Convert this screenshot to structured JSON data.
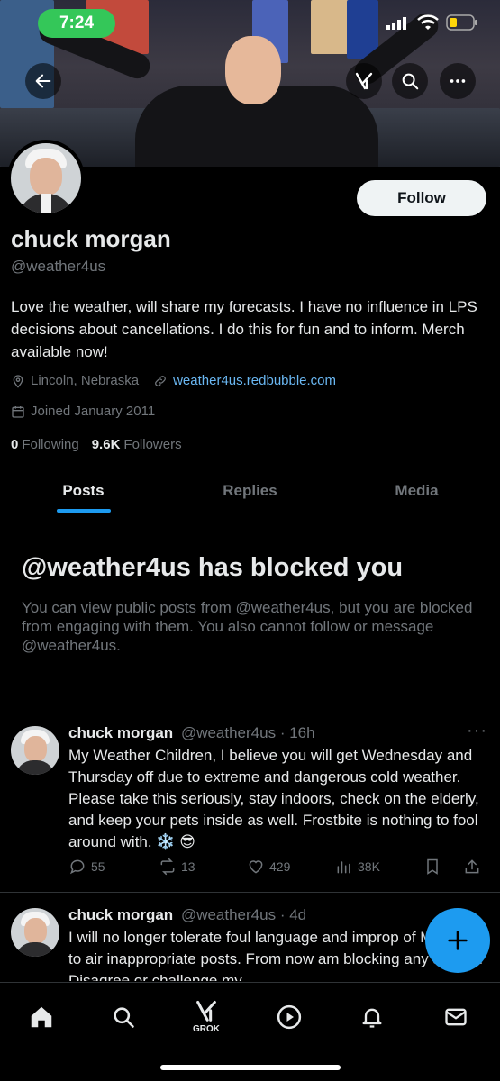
{
  "status_bar": {
    "time": "7:24"
  },
  "profile": {
    "display_name": "chuck morgan",
    "handle": "@weather4us",
    "follow_label": "Follow",
    "bio": "Love the weather, will share my forecasts. I have no influence in LPS decisions about cancellations. I do this for fun and to inform. Merch available now!",
    "location": "Lincoln, Nebraska",
    "website": "weather4us.redbubble.com",
    "joined": "Joined January 2011",
    "following_count": "0",
    "following_label": "Following",
    "followers_count": "9.6K",
    "followers_label": "Followers"
  },
  "tabs": [
    {
      "label": "Posts",
      "active": true
    },
    {
      "label": "Replies",
      "active": false
    },
    {
      "label": "Media",
      "active": false
    }
  ],
  "blocked_notice": {
    "title": "@weather4us has blocked you",
    "text": "You can view public posts from @weather4us, but you are blocked from engaging with them. You also cannot follow or message @weather4us."
  },
  "posts": [
    {
      "name": "chuck morgan",
      "handle": "@weather4us",
      "time": "· 16h",
      "text": "My Weather Children, I believe you will get Wednesday and Thursday off due to extreme and dangerous cold weather. Please take this seriously, stay indoors, check on the elderly, and keep your pets inside as well. Frostbite is nothing to fool around with. ❄️ 😎",
      "replies": "55",
      "reposts": "13",
      "likes": "429",
      "views": "38K"
    },
    {
      "name": "chuck morgan",
      "handle": "@weather4us",
      "time": "· 4d",
      "text": "I will no longer tolerate foul language and improp of MY page to air inappropriate posts. From now am blocking any abuser. Disagree or challenge my"
    }
  ],
  "bottom_nav": {
    "grok_label": "GROK"
  },
  "colors": {
    "accent": "#1d9bf0",
    "link": "#6ab7f2",
    "muted": "#71767b",
    "text": "#e7e9ea"
  },
  "icons": [
    "back-arrow-icon",
    "grok-icon",
    "search-icon",
    "more-icon",
    "location-icon",
    "link-icon",
    "calendar-icon",
    "reply-icon",
    "repost-icon",
    "like-icon",
    "views-icon",
    "bookmark-icon",
    "share-icon",
    "compose-icon",
    "home-icon",
    "play-icon",
    "bell-icon",
    "mail-icon"
  ]
}
